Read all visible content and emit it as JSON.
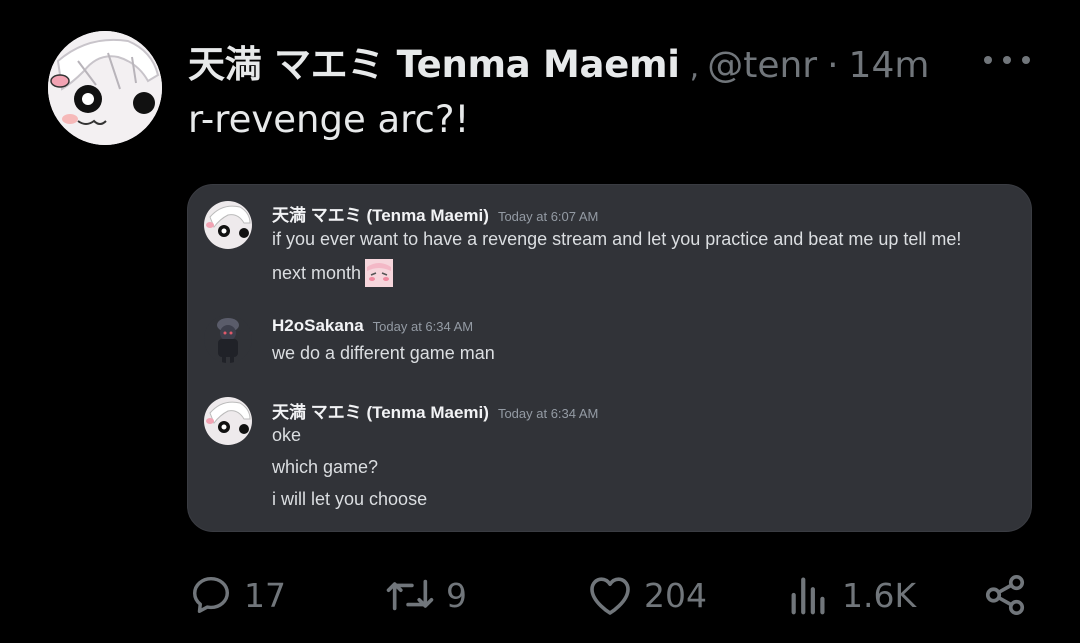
{
  "tweet": {
    "author_name": "天満 マエミ Tenma Maemi",
    "verified_mark": ",",
    "handle": "@tenr",
    "separator": "·",
    "time": "14m",
    "text": "r-revenge arc?!"
  },
  "embed": {
    "messages": [
      {
        "author": "天満 マエミ (Tenma Maemi)",
        "timestamp": "Today at 6:07 AM",
        "lines": [
          "if you ever want to have a revenge stream and let you practice and beat me up tell me!",
          "next month"
        ],
        "emote": "blush-emote-icon"
      },
      {
        "author": "H2oSakana",
        "timestamp": "Today at 6:34 AM",
        "lines": [
          "we do a different game man"
        ]
      },
      {
        "author": "天満 マエミ (Tenma Maemi)",
        "timestamp": "Today at 6:34 AM",
        "lines": [
          "oke",
          "which game?",
          "i will let you choose"
        ]
      }
    ]
  },
  "actions": {
    "replies": "17",
    "reposts": "9",
    "likes": "204",
    "views": "1.6K"
  },
  "icons": {
    "reply": "reply-icon",
    "repost": "repost-icon",
    "like": "heart-icon",
    "views": "views-icon",
    "share": "share-icon",
    "more": "more-icon"
  },
  "colors": {
    "background": "#000000",
    "text": "#e7e9ea",
    "muted": "#71767b",
    "embed_bg": "#313338"
  }
}
